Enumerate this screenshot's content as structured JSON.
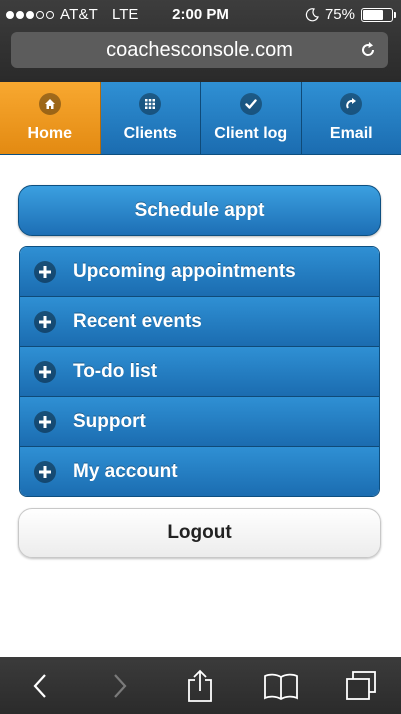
{
  "status_bar": {
    "carrier": "AT&T",
    "network": "LTE",
    "time": "2:00 PM",
    "battery": "75%",
    "battery_level": 0.75,
    "signal_bars_filled": 3,
    "signal_bars_total": 5
  },
  "browser": {
    "url": "coachesconsole.com"
  },
  "nav": {
    "tabs": [
      {
        "label": "Home",
        "icon": "home-icon",
        "active": true
      },
      {
        "label": "Clients",
        "icon": "grid-icon",
        "active": false
      },
      {
        "label": "Client log",
        "icon": "check-icon",
        "active": false
      },
      {
        "label": "Email",
        "icon": "reply-arrow-icon",
        "active": false
      }
    ]
  },
  "main": {
    "schedule_label": "Schedule appt",
    "sections": [
      {
        "label": "Upcoming appointments"
      },
      {
        "label": "Recent events"
      },
      {
        "label": "To-do list"
      },
      {
        "label": "Support"
      },
      {
        "label": "My account"
      }
    ],
    "logout_label": "Logout"
  },
  "colors": {
    "nav_active": "#f29a1e",
    "primary_blue": "#1f77bf",
    "chrome_dark": "#333333"
  }
}
